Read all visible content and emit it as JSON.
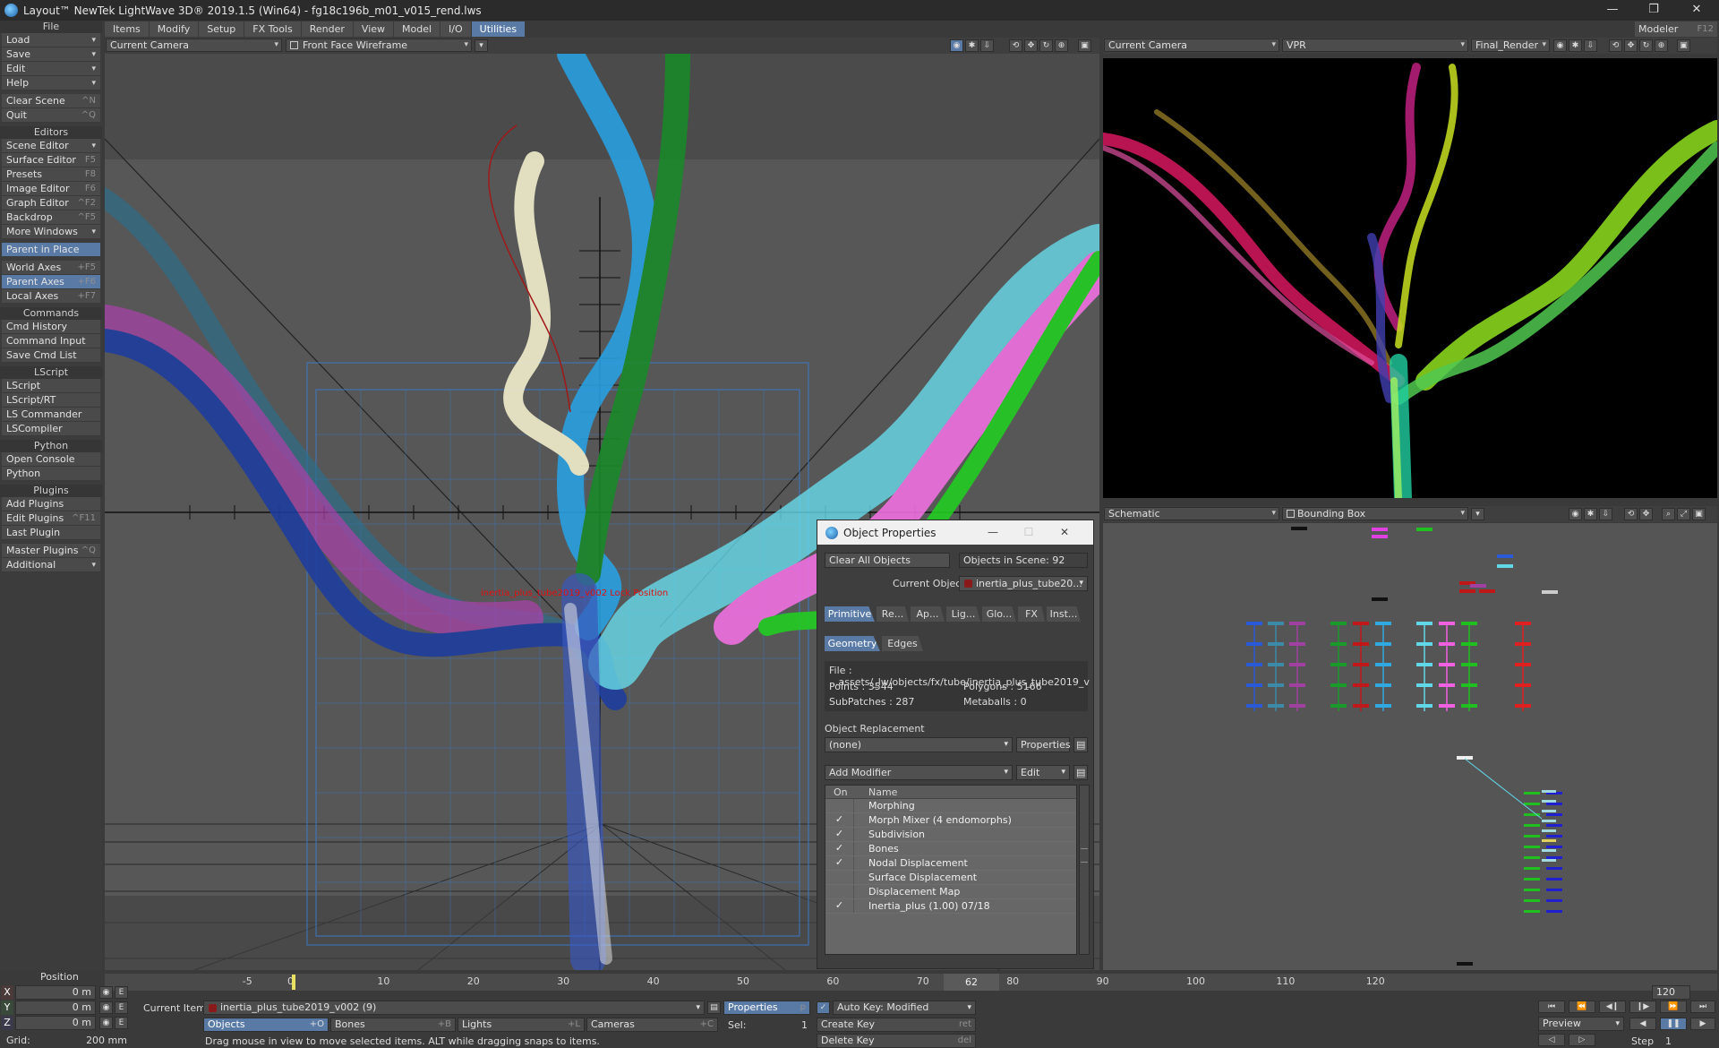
{
  "window": {
    "title": "Layout™ NewTek LightWave 3D® 2019.1.5 (Win64) - fg18c196b_m01_v015_rend.lws",
    "controls": [
      "—",
      "❐",
      "✕"
    ]
  },
  "menu_tabs": [
    "Items",
    "Modify",
    "Setup",
    "FX Tools",
    "Render",
    "View",
    "Model",
    "I/O",
    "Utilities"
  ],
  "modeler": {
    "label": "Modeler",
    "shortcut": "F12"
  },
  "sidebar": {
    "file": {
      "head": "File",
      "items": [
        {
          "label": "Load",
          "dd": "▾"
        },
        {
          "label": "Save",
          "dd": "▾"
        },
        {
          "label": "Edit",
          "dd": "▾"
        },
        {
          "label": "Help",
          "dd": "▾"
        },
        {
          "label": "Clear Scene",
          "sc": "^N"
        },
        {
          "label": "Quit",
          "sc": "^Q"
        }
      ]
    },
    "editors": {
      "head": "Editors",
      "items": [
        {
          "label": "Scene Editor",
          "dd": "▾"
        },
        {
          "label": "Surface Editor",
          "sc": "F5"
        },
        {
          "label": "Presets",
          "sc": "F8"
        },
        {
          "label": "Image Editor",
          "sc": "F6"
        },
        {
          "label": "Graph Editor",
          "sc": "^F2"
        },
        {
          "label": "Backdrop",
          "sc": "^F5"
        },
        {
          "label": "More Windows",
          "dd": "▾"
        },
        {
          "label": "Parent in Place"
        },
        {
          "label": "World Axes",
          "sc": "+F5"
        },
        {
          "label": "Parent Axes",
          "sc": "+F6"
        },
        {
          "label": "Local Axes",
          "sc": "+F7"
        }
      ]
    },
    "commands": {
      "head": "Commands",
      "items": [
        {
          "label": "Cmd History"
        },
        {
          "label": "Command Input"
        },
        {
          "label": "Save Cmd List"
        }
      ]
    },
    "lscript": {
      "head": "LScript",
      "items": [
        {
          "label": "LScript"
        },
        {
          "label": "LScript/RT"
        },
        {
          "label": "LS Commander"
        },
        {
          "label": "LSCompiler"
        }
      ]
    },
    "python": {
      "head": "Python",
      "items": [
        {
          "label": "Open Console"
        },
        {
          "label": "Python"
        }
      ]
    },
    "plugins": {
      "head": "Plugins",
      "items": [
        {
          "label": "Add Plugins"
        },
        {
          "label": "Edit Plugins",
          "sc": "^F11"
        },
        {
          "label": "Last Plugin"
        },
        {
          "label": "Master Plugins",
          "sc": "^Q"
        },
        {
          "label": "Additional",
          "dd": "▾"
        }
      ]
    }
  },
  "viewport_main": {
    "camera": "Current Camera",
    "render_mode": "Front Face Wireframe",
    "overlay_label": "inertia_plus_tube2019_v002 Lock Position"
  },
  "viewport_render": {
    "camera": "Current Camera",
    "mode": "VPR",
    "preset": "Final_Render"
  },
  "viewport_schematic": {
    "mode": "Schematic",
    "display": "Bounding Box"
  },
  "object_properties": {
    "title": "Object Properties",
    "clear_all": "Clear All Objects",
    "objects_in_scene": "Objects in Scene: 92",
    "current_object_label": "Current Object",
    "current_object": "inertia_plus_tube20...",
    "tabs": [
      "Primitive",
      "Re...",
      "Ap...",
      "Lig...",
      "Glo...",
      "FX",
      "Inst..."
    ],
    "subtabs": [
      "Geometry",
      "Edges"
    ],
    "file": "File : ...assets/_lw/objects/fx/tube/inertia_plus_tube2019_v",
    "points": "Points : 3544",
    "polygons": "Polygons : 5166",
    "subpatches": "SubPatches : 287",
    "metaballs": "Metaballs : 0",
    "replacement_label": "Object Replacement",
    "replacement_value": "(none)",
    "properties_btn": "Properties",
    "add_modifier": "Add Modifier",
    "edit_btn": "Edit",
    "col_on": "On",
    "col_name": "Name",
    "modifiers": [
      {
        "name": "Morphing",
        "on": ""
      },
      {
        "name": "Morph Mixer (4 endomorphs)",
        "on": "✓"
      },
      {
        "name": "Subdivision",
        "on": "✓"
      },
      {
        "name": "Bones",
        "on": "✓"
      },
      {
        "name": "Nodal Displacement",
        "on": "✓"
      },
      {
        "name": "Surface Displacement",
        "on": ""
      },
      {
        "name": "Displacement Map",
        "on": ""
      },
      {
        "name": "Inertia_plus (1.00) 07/18",
        "on": "✓"
      }
    ]
  },
  "timeline": {
    "ticks": [
      "-5",
      "0",
      "10",
      "20",
      "30",
      "40",
      "50",
      "60",
      "70",
      "80",
      "90",
      "100",
      "110",
      "120"
    ],
    "current_frame": "62",
    "end_frame": "120"
  },
  "bottom": {
    "position_label": "Position",
    "x_value": "0 m",
    "y_value": "0 m",
    "z_value": "0 m",
    "grid_label": "Grid:",
    "grid_value": "200 mm",
    "current_item_label": "Current Item",
    "current_item": "inertia_plus_tube2019_v002 (9)",
    "properties": "Properties",
    "properties_sc": "p",
    "objects": "Objects",
    "objects_sc": "+O",
    "bones": "Bones",
    "bones_sc": "+B",
    "lights": "Lights",
    "lights_sc": "+L",
    "cameras": "Cameras",
    "cameras_sc": "+C",
    "sel_label": "Sel:",
    "sel_value": "1",
    "auto_key": "Auto Key: Modified",
    "create_key": "Create Key",
    "create_key_sc": "ret",
    "delete_key": "Delete Key",
    "delete_key_sc": "del",
    "status": "Drag mouse in view to move selected items. ALT while dragging snaps to items.",
    "preview": "Preview",
    "step_label": "Step",
    "step_value": "1"
  }
}
